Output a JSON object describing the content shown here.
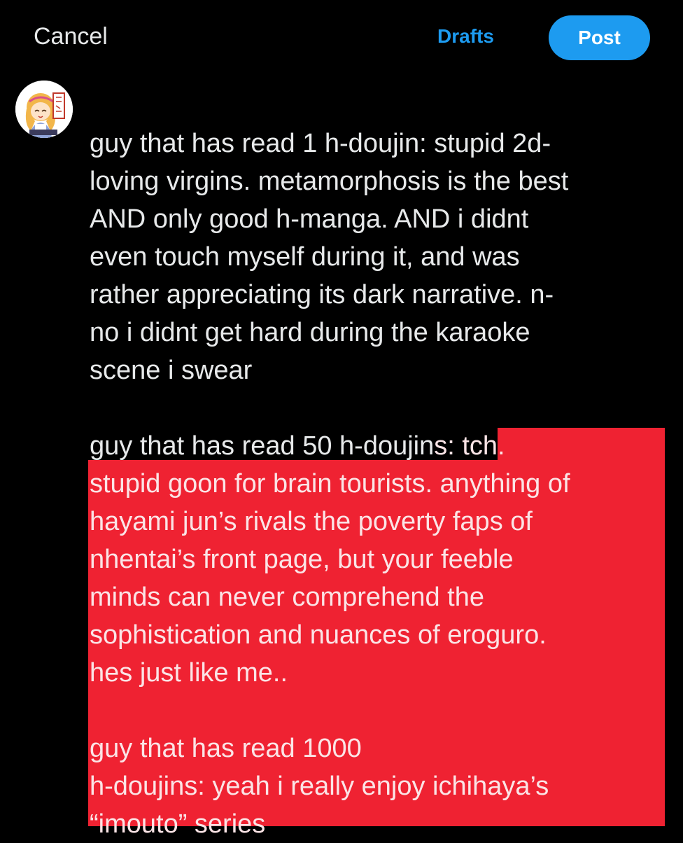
{
  "header": {
    "cancel_label": "Cancel",
    "drafts_label": "Drafts",
    "post_label": "Post"
  },
  "colors": {
    "background": "#000000",
    "text": "#e7e9ea",
    "accent": "#1d9bf0",
    "highlight": "#ef2232"
  },
  "avatar": {
    "icon": "anime-avatar"
  },
  "composer": {
    "lines": [
      "guy that has read 1 h-doujin: stupid 2d-",
      "loving virgins. metamorphosis is the best",
      "AND only good h-manga. AND i didnt",
      "even touch myself during it, and was",
      "rather appreciating its dark narrative. n-",
      "no i didnt get hard during the karaoke",
      "scene i swear",
      "",
      "guy that has read 50 h-doujin",
      "s: tch.",
      "stupid goon for brain tourists. anything of",
      "hayami jun’s rivals the poverty faps of",
      "nhentai’s front page, but your feeble",
      "minds can never comprehend the",
      "sophistication and nuances of eroguro.",
      "hes just like me..",
      "",
      "guy that has read 1000",
      "h-doujins: yeah i really enjoy ichihaya’s",
      "“imouto” series"
    ]
  }
}
